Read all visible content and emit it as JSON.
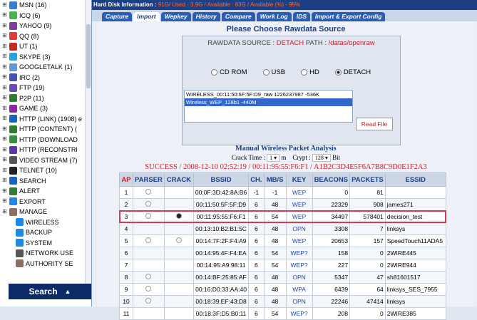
{
  "sidebar": {
    "items": [
      {
        "label": "MSN (16)",
        "icon": "msn-icon",
        "color": "#3a7bd5"
      },
      {
        "label": "ICQ (6)",
        "icon": "icq-icon",
        "color": "#4caf50"
      },
      {
        "label": "YAHOO (9)",
        "icon": "yahoo-icon",
        "color": "#7b3fa0"
      },
      {
        "label": "QQ (8)",
        "icon": "qq-icon",
        "color": "#e53935"
      },
      {
        "label": "UT (1)",
        "icon": "ut-icon",
        "color": "#c62828"
      },
      {
        "label": "SKYPE (3)",
        "icon": "skype-icon",
        "color": "#29a3e0"
      },
      {
        "label": "GOOGLETALK (1)",
        "icon": "googletalk-icon",
        "color": "#5c9ad6"
      },
      {
        "label": "IRC (2)",
        "icon": "irc-icon",
        "color": "#3f51b5"
      },
      {
        "label": "FTP (19)",
        "icon": "ftp-icon",
        "color": "#6a4caf"
      },
      {
        "label": "P2P (11)",
        "icon": "p2p-icon",
        "color": "#2e7d32"
      },
      {
        "label": "GAME (3)",
        "icon": "game-icon",
        "color": "#8e24aa"
      },
      {
        "label": "HTTP (LINK) (1908) e",
        "icon": "http-link-icon",
        "color": "#1565c0"
      },
      {
        "label": "HTTP (CONTENT) (",
        "icon": "http-content-icon",
        "color": "#2e7d32"
      },
      {
        "label": "HTTP (DOWNLOAD",
        "icon": "http-download-icon",
        "color": "#388e3c"
      },
      {
        "label": "HTTP (RECONSTRI",
        "icon": "http-reconstruct-icon",
        "color": "#5e35b1"
      },
      {
        "label": "VIDEO STREAM (7)",
        "icon": "video-stream-icon",
        "color": "#555555"
      },
      {
        "label": "TELNET (10)",
        "icon": "telnet-icon",
        "color": "#222222"
      },
      {
        "label": "SEARCH",
        "icon": "search-icon",
        "color": "#1565c0"
      },
      {
        "label": "ALERT",
        "icon": "alert-icon",
        "color": "#2e7d32"
      },
      {
        "label": "EXPORT",
        "icon": "export-icon",
        "color": "#1e88e5"
      },
      {
        "label": "MANAGE",
        "icon": "manage-icon",
        "color": "#8d6e63"
      }
    ],
    "children": [
      {
        "label": "WIRELESS",
        "icon": "wireless-icon",
        "color": "#1e88e5"
      },
      {
        "label": "BACKUP",
        "icon": "backup-icon",
        "color": "#1e88e5"
      },
      {
        "label": "SYSTEM",
        "icon": "system-icon",
        "color": "#1e88e5"
      },
      {
        "label": "NETWORK USE",
        "icon": "network-use-icon",
        "color": "#555555"
      },
      {
        "label": "AUTHORITY SE",
        "icon": "authority-icon",
        "color": "#8d6e63"
      }
    ],
    "search_label": "Search",
    "search_arrow": "▲"
  },
  "infobar": {
    "label": "Hard Disk Information :",
    "total": "91G",
    "used_label": "/ Used - ",
    "used": "3.9G",
    "avail_label": " / Available : ",
    "avail": "83G",
    "pct_label": " / Available (%) - ",
    "pct": "95%"
  },
  "tabs": [
    "Capture",
    "Import",
    "Wepkey",
    "History",
    "Compare",
    "Work Log",
    "IDS",
    "Import & Export Config"
  ],
  "active_tab": 1,
  "panel": {
    "title": "Please Choose Rawdata Source",
    "source_label": "RAWDATA SOURCE :",
    "source_mode": "DETACH",
    "path_label": "PATH :",
    "path": "/datas/openraw",
    "radios": [
      "CD ROM",
      "USB",
      "HD",
      "DETACH"
    ],
    "radio_selected": 3,
    "files": [
      "WIRELESS_00:11:50:5F:5F:D9_raw 1226237987 -536K",
      "Wireless_WEP_128b1 -440M"
    ],
    "selected_file": 1,
    "read_button": "Read File"
  },
  "analysis": {
    "title": "Manual Wireless Packet Analysis",
    "crack_time_label": "Crack Time :",
    "crack_time": "1",
    "crack_time_unit": "m",
    "crypt_label": "Crypt :",
    "crypt": "128",
    "crypt_unit": "Bit",
    "success_text": "SUCCESS / 2008-12-10 02:52:19 / 00:11:95:55:F6:F1 / A1B2C3D4E5F6A7B8C9D0E1F2A3"
  },
  "table": {
    "headers": [
      "AP",
      "PARSER",
      "CRACK",
      "BSSID",
      "CH.",
      "MB/S",
      "KEY",
      "BEACONS",
      "PACKETS",
      "ESSID"
    ],
    "highlight_row": 2,
    "rows": [
      {
        "ap": "1",
        "parser": true,
        "crack": false,
        "bssid": "00:0F:3D:42:8A:B6",
        "ch": "-1",
        "mbs": "-1",
        "key": "WEP",
        "beacons": "0",
        "packets": "81",
        "essid": ""
      },
      {
        "ap": "2",
        "parser": true,
        "crack": false,
        "bssid": "00:11:50:5F:5F:D9",
        "ch": "6",
        "mbs": "48",
        "key": "WEP",
        "beacons": "22329",
        "packets": "908",
        "essid": "james271"
      },
      {
        "ap": "3",
        "parser": true,
        "crack": true,
        "crack_on": true,
        "bssid": "00:11:95:55:F6:F1",
        "ch": "6",
        "mbs": "54",
        "key": "WEP",
        "beacons": "34497",
        "packets": "578401",
        "essid": "decision_test"
      },
      {
        "ap": "4",
        "parser": false,
        "crack": false,
        "bssid": "00:13:10:B2:B1:5C",
        "ch": "6",
        "mbs": "48",
        "key": "OPN",
        "beacons": "3308",
        "packets": "7",
        "essid": "linksys"
      },
      {
        "ap": "5",
        "parser": true,
        "crack": true,
        "bssid": "00:14:7F:2F:F4:A9",
        "ch": "6",
        "mbs": "48",
        "key": "WEP",
        "beacons": "20653",
        "packets": "157",
        "essid": "SpeedTouch11ADA5"
      },
      {
        "ap": "6",
        "parser": false,
        "crack": false,
        "bssid": "00:14:95:4F:F4:EA",
        "ch": "6",
        "mbs": "54",
        "key": "WEP?",
        "beacons": "158",
        "packets": "0",
        "essid": "2WIRE445"
      },
      {
        "ap": "7",
        "parser": false,
        "crack": false,
        "bssid": "00:14:95:A9:98:11",
        "ch": "6",
        "mbs": "54",
        "key": "WEP?",
        "beacons": "227",
        "packets": "0",
        "essid": "2WIRE944"
      },
      {
        "ap": "8",
        "parser": true,
        "crack": false,
        "bssid": "00:14:BF:25:85:AF",
        "ch": "6",
        "mbs": "48",
        "key": "OPN",
        "beacons": "5347",
        "packets": "47",
        "essid": "sh81601517"
      },
      {
        "ap": "9",
        "parser": true,
        "crack": false,
        "bssid": "00:16:D0:33:AA:40",
        "ch": "6",
        "mbs": "48",
        "key": "WPA",
        "beacons": "6439",
        "packets": "64",
        "essid": "linksys_SES_7955"
      },
      {
        "ap": "10",
        "parser": true,
        "crack": false,
        "bssid": "00:18:39:EF:43:D8",
        "ch": "6",
        "mbs": "48",
        "key": "OPN",
        "beacons": "22246",
        "packets": "47414",
        "essid": "linksys"
      },
      {
        "ap": "11",
        "parser": false,
        "crack": false,
        "bssid": "00:18:3F:D5:B0:11",
        "ch": "6",
        "mbs": "54",
        "key": "WEP?",
        "beacons": "208",
        "packets": "0",
        "essid": "2WIRE385"
      }
    ]
  }
}
